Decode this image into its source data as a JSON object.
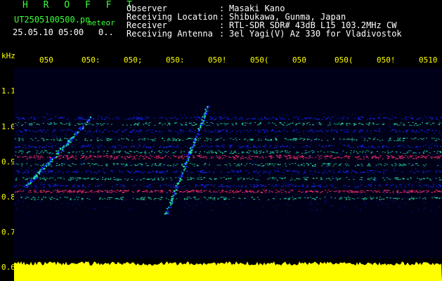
{
  "header": {
    "title": "H R O F F T",
    "file_name": "UT2505100500.pn",
    "meteor_label": "meteor",
    "datetime": "25.05.10 05:00",
    "meteor_count": "0.."
  },
  "info": [
    {
      "key": "Observer",
      "value": "Masaki Kano"
    },
    {
      "key": "Receiving Location",
      "value": "Shibukawa, Gunma, Japan"
    },
    {
      "key": "Receiver",
      "value": "RTL-SDR SDR# 43dB L15 103.2MHz CW"
    },
    {
      "key": "Receiving Antenna",
      "value": "3el Yagi(V) Az 330 for Vladivostok"
    }
  ],
  "info_separator": ":",
  "axis": {
    "y_unit": "kHz",
    "y_ticks": [
      "1.1",
      "1.0",
      "0.9",
      "0.8",
      "0.7",
      "0.6"
    ],
    "x_ticks": [
      "050",
      "050:",
      "050;",
      "050:",
      "050!",
      "050(",
      "050",
      "050(",
      "050!",
      "0510"
    ]
  },
  "colors": {
    "background": "#000000",
    "plot_background": "#000018",
    "title": "#39ff39",
    "text": "#ffffff",
    "axis": "#ffff00",
    "signal_low": "#1428ff",
    "signal_mid": "#28e0a0",
    "signal_high": "#ff3070",
    "amplitude": "#ffff00"
  }
}
